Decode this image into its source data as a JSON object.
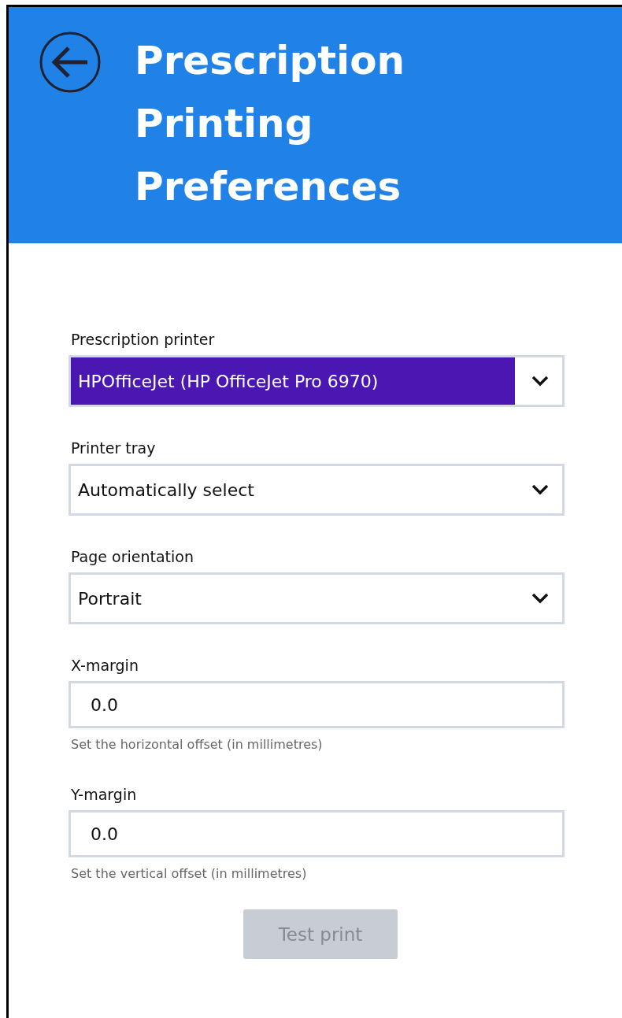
{
  "header": {
    "title": "Prescription Printing Preferences"
  },
  "fields": [
    {
      "kind": "select",
      "label": "Prescription printer",
      "value": "HPOfficeJet (HP OfficeJet Pro 6970)",
      "highlighted": true
    },
    {
      "kind": "select",
      "label": "Printer tray",
      "value": "Automatically select",
      "highlighted": false
    },
    {
      "kind": "select",
      "label": "Page orientation",
      "value": "Portrait",
      "highlighted": false
    },
    {
      "kind": "number",
      "label": "X-margin",
      "value": "0.0",
      "hint": "Set the horizontal offset (in millimetres)"
    },
    {
      "kind": "number",
      "label": "Y-margin",
      "value": "0.0",
      "hint": "Set the vertical offset (in millimetres)"
    }
  ],
  "button": {
    "label": "Test print",
    "disabled": true
  }
}
